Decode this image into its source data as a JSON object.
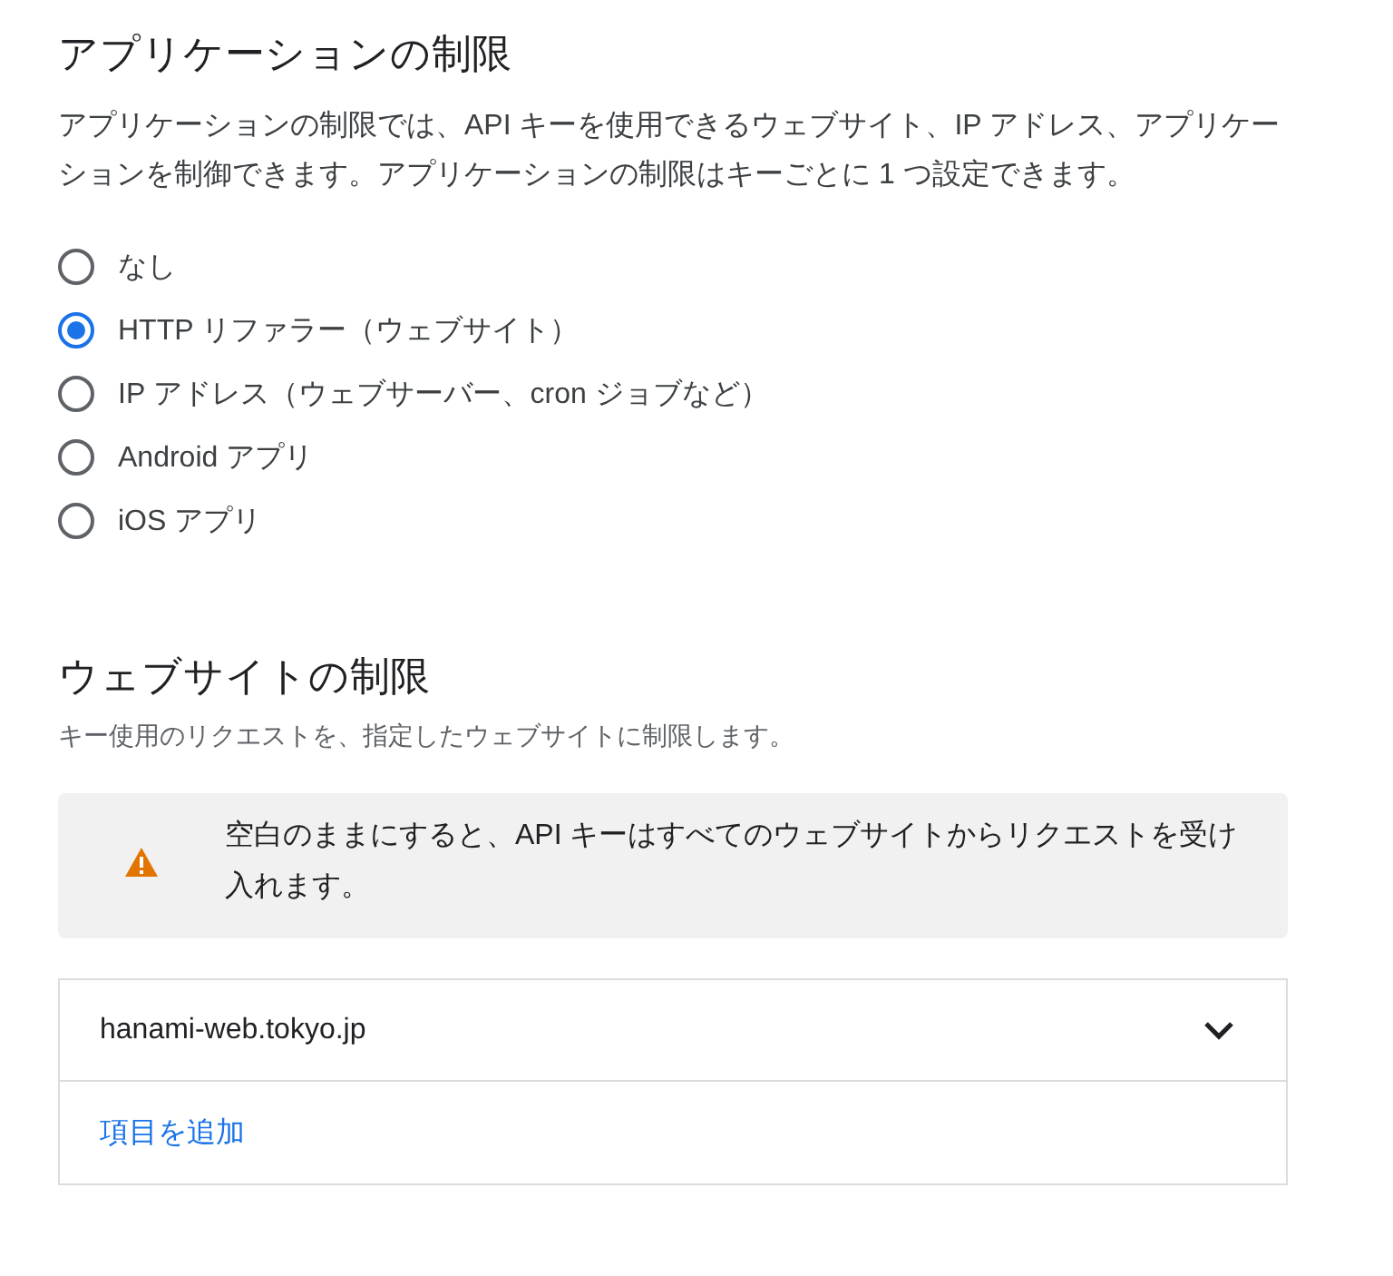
{
  "app_restrictions": {
    "title": "アプリケーションの制限",
    "description": "アプリケーションの制限では、API キーを使用できるウェブサイト、IP アドレス、アプリケーションを制御できます。アプリケーションの制限はキーごとに 1 つ設定できます。",
    "options": [
      {
        "label": "なし",
        "selected": false
      },
      {
        "label": "HTTP リファラー（ウェブサイト）",
        "selected": true
      },
      {
        "label": "IP アドレス（ウェブサーバー、cron ジョブなど）",
        "selected": false
      },
      {
        "label": "Android アプリ",
        "selected": false
      },
      {
        "label": "iOS アプリ",
        "selected": false
      }
    ]
  },
  "website_restrictions": {
    "title": "ウェブサイトの制限",
    "description": "キー使用のリクエストを、指定したウェブサイトに制限します。",
    "warning": "空白のままにすると、API キーはすべてのウェブサイトからリクエストを受け入れます。",
    "items": [
      {
        "value": "hanami-web.tokyo.jp"
      }
    ],
    "add_link": "項目を追加"
  }
}
